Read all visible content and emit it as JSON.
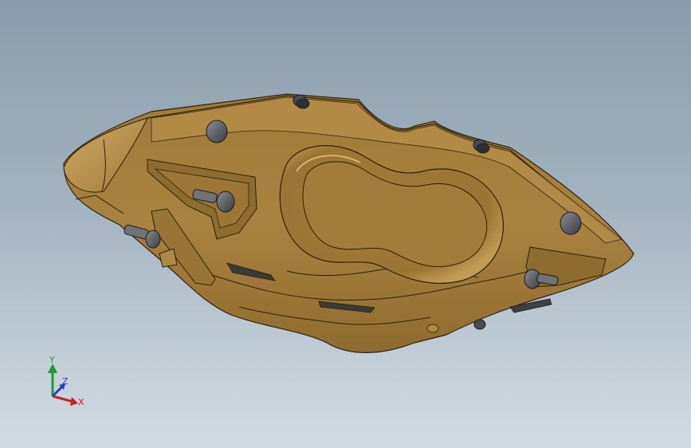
{
  "viewport": {
    "background_top": "#8a9cab",
    "background_bottom": "#d2dbe2"
  },
  "model": {
    "body_color": "#a98240",
    "body_shade": "#7f5f28",
    "body_highlight": "#c9a25a",
    "fastener_color": "#3c3e42"
  },
  "triad": {
    "x_label": "X",
    "y_label": "Y",
    "z_label": "Z",
    "x_color": "#c8202a",
    "y_color": "#1f9a3a",
    "z_color": "#2a3fb8"
  }
}
